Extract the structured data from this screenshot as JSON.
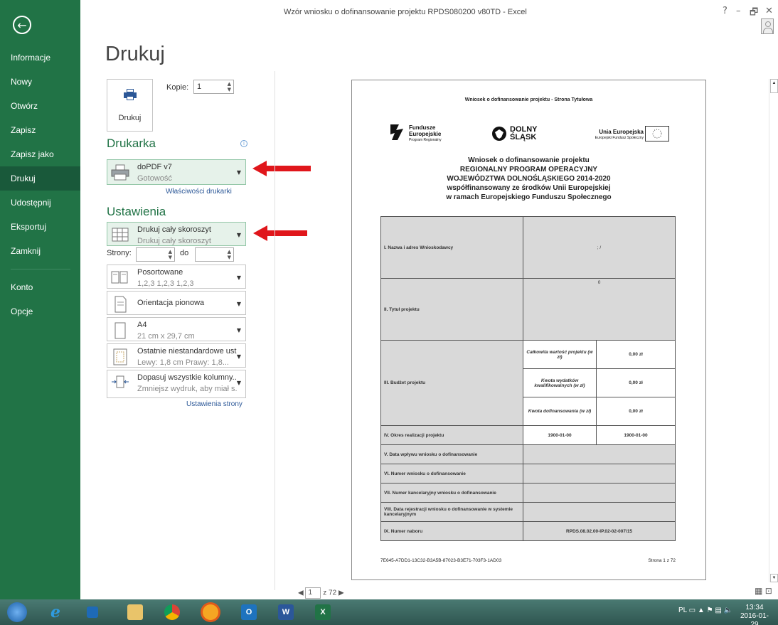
{
  "window": {
    "title": "Wzór wniosku o dofinansowanie projektu RPDS080200 v80TD - Excel",
    "help": "?",
    "minimize": "–",
    "restore": "🗗",
    "close": "✕"
  },
  "sidebar": {
    "back": "←",
    "items": [
      {
        "label": "Informacje"
      },
      {
        "label": "Nowy"
      },
      {
        "label": "Otwórz"
      },
      {
        "label": "Zapisz"
      },
      {
        "label": "Zapisz jako"
      },
      {
        "label": "Drukuj"
      },
      {
        "label": "Udostępnij"
      },
      {
        "label": "Eksportuj"
      },
      {
        "label": "Zamknij"
      },
      {
        "label": "Konto"
      },
      {
        "label": "Opcje"
      }
    ],
    "active": "Drukuj"
  },
  "print": {
    "title": "Drukuj",
    "button_label": "Drukuj",
    "copies_label": "Kopie:",
    "copies_value": "1",
    "printer_heading": "Drukarka",
    "printer_name": "doPDF v7",
    "printer_status": "Gotowość",
    "printer_properties": "Właściwości drukarki",
    "settings_heading": "Ustawienia",
    "scope_main": "Drukuj cały skoroszyt",
    "scope_sub": "Drukuj cały skoroszyt",
    "pages_label": "Strony:",
    "pages_to": "do",
    "collate_main": "Posortowane",
    "collate_sub": "1,2,3   1,2,3   1,2,3",
    "orientation": "Orientacja pionowa",
    "paper_main": "A4",
    "paper_sub": "21  cm x 29,7  cm",
    "margins_main": "Ostatnie niestandardowe ust...",
    "margins_sub": "Lewy:  1,8  cm    Prawy:  1,8...",
    "scaling_main": "Dopasuj wszystkie kolumny...",
    "scaling_sub": "Zmniejsz wydruk, aby miał s...",
    "page_setup_link": "Ustawienia strony"
  },
  "preview": {
    "header": "Wniosek o dofinansowanie projektu - Strona Tytułowa",
    "logo1_l1": "Fundusze",
    "logo1_l2": "Europejskie",
    "logo1_l3": "Program Regionalny",
    "logo2_l1": "DOLNY",
    "logo2_l2": "ŚLĄSK",
    "logo3_l1": "Unia Europejska",
    "logo3_l2": "Europejski Fundusz Społeczny",
    "title_lines": [
      "Wniosek o dofinansowanie projektu",
      "REGIONALNY PROGRAM OPERACYJNY",
      "WOJEWÓDZTWA DOLNOŚLĄSKIEGO 2014-2020",
      "współfinansowany ze środków Unii Europejskiej",
      "w ramach Europejskiego Funduszu Społecznego"
    ],
    "rows": {
      "r1_label": "I.   Nazwa i adres Wnioskodawcy",
      "r1_value": "; /",
      "r2_label": "II.  Tytuł projektu",
      "r2_value": "0",
      "r3_label": "III.   Budżet projektu",
      "r3a_label": "Całkowita wartość projektu (w zł)",
      "r3a_value": "0,00 zł",
      "r3b_label": "Kwota wydatków kwalifikowalnych (w zł)",
      "r3b_value": "0,00 zł",
      "r3c_label": "Kwota dofinansowania (w zł)",
      "r3c_value": "0,00 zł",
      "r4_label": "IV. Okres realizacji projektu",
      "r4_from": "1900-01-00",
      "r4_to": "1900-01-00",
      "r5_label": "V. Data wpływu wniosku o dofinansowanie",
      "r6_label": "VI. Numer wniosku o dofinansowanie",
      "r7_label": "VII.   Numer kancelaryjny wniosku o dofinansowanie",
      "r8_label": "VIII. Data rejestracji wniosku o dofinansowanie w systemie kancelaryjnym",
      "r9_label": "IX. Numer naboru",
      "r9_value": "RPDS.08.02.00-IP.02-02-007/15"
    },
    "footer_id": "7E645-A7DD1-13C32-B3A5B-87023-B3E71-703F3-1AD03",
    "footer_page": "Strona 1 z 72"
  },
  "pager": {
    "prev": "◀",
    "current": "1",
    "total": "z 72",
    "next": "▶"
  },
  "taskbar": {
    "lang": "PL",
    "time": "13:34",
    "date": "2016-01-29"
  },
  "colors": {
    "accent": "#217346",
    "arrow": "#e0161b"
  }
}
